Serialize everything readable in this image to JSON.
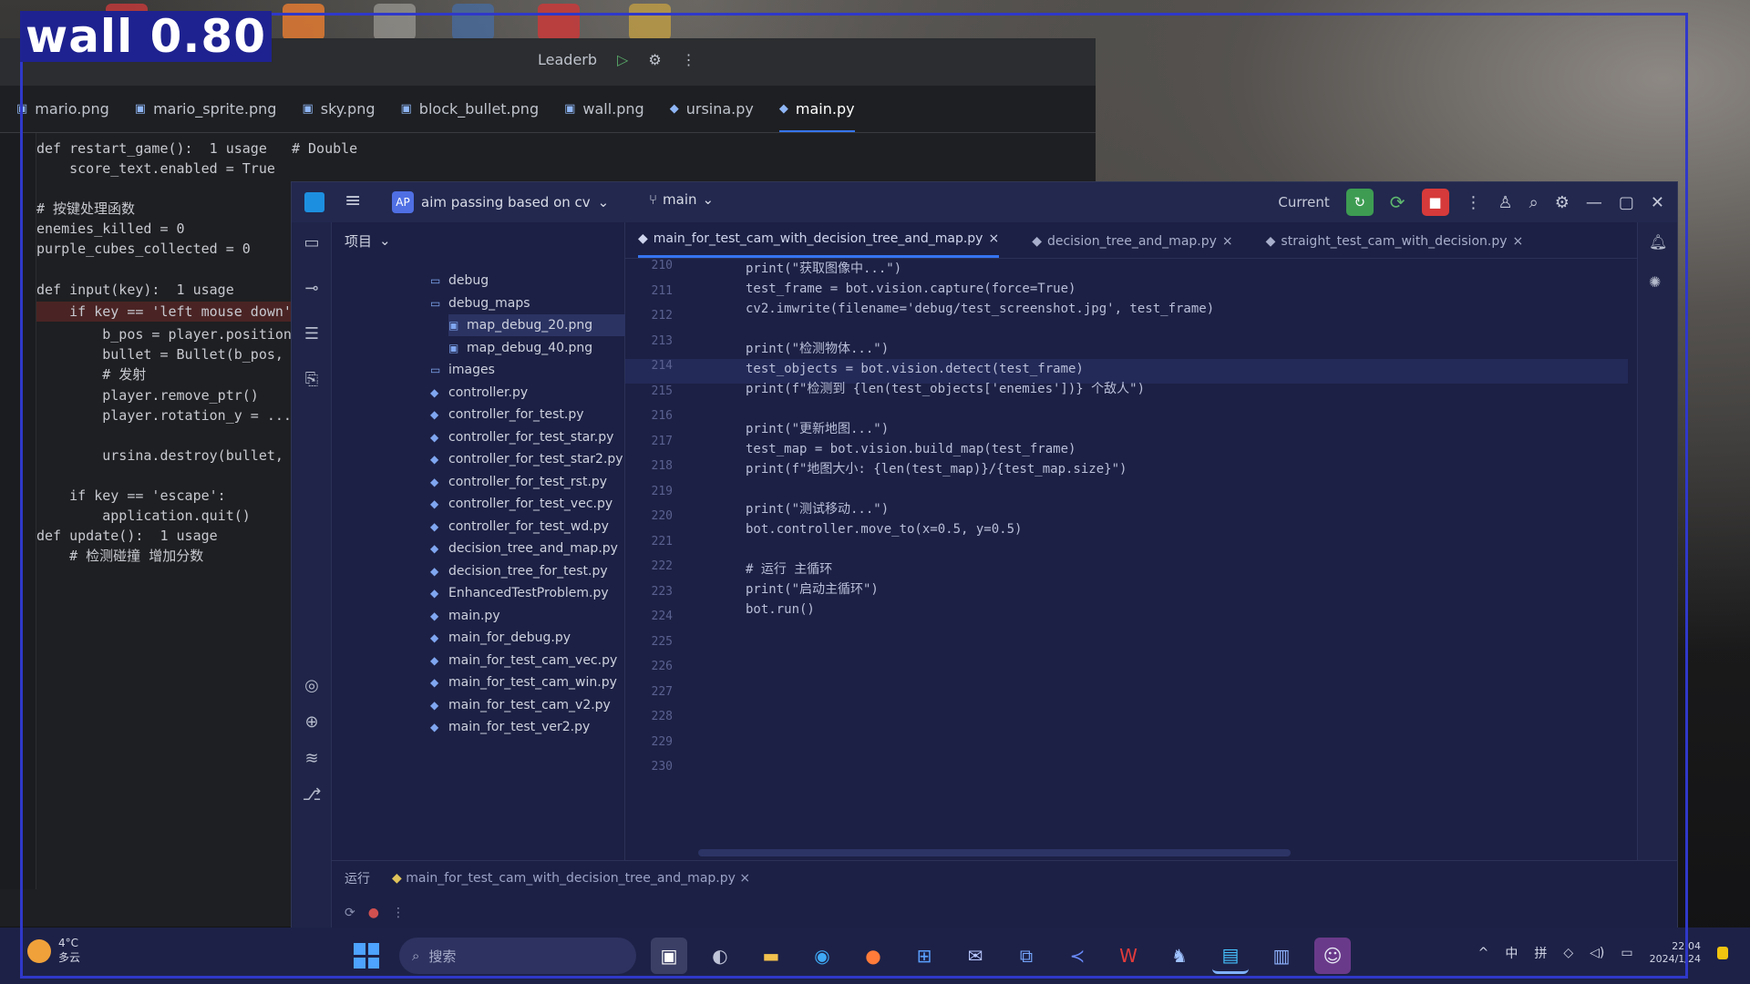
{
  "overlay": {
    "label": "wall 0.80"
  },
  "back_window": {
    "title_items": [
      "Leaderb",
      "▷",
      "⚙",
      "⋮"
    ],
    "tabs": [
      {
        "label": "mario.png",
        "active": false
      },
      {
        "label": "mario_sprite.png",
        "active": false
      },
      {
        "label": "sky.png",
        "active": false
      },
      {
        "label": "block_bullet.png",
        "active": false
      },
      {
        "label": "wall.png",
        "active": false
      },
      {
        "label": "ursina.py",
        "active": false
      },
      {
        "label": "main.py",
        "active": true
      }
    ],
    "code_lines": [
      "def restart_game():  1 usage   # Double",
      "    score_text.enabled = True",
      "",
      "# 按键处理函数",
      "enemies_killed = 0",
      "purple_cubes_collected = 0",
      "",
      "def input(key):  1 usage",
      "    if key == 'left mouse down':",
      "        b_pos = player.position",
      "        bullet = Bullet(b_pos, ...)",
      "        # 发射",
      "        player.remove_ptr()",
      "        player.rotation_y = ...",
      "",
      "        ursina.destroy(bullet, ...)",
      "",
      "    if key == 'escape':",
      "        application.quit()",
      "def update():  1 usage",
      "    # 检测碰撞 增加分数"
    ]
  },
  "front_window": {
    "project_name": "aim passing based on cv",
    "branch": "main",
    "run_config": "Current",
    "project_panel_title": "项目",
    "tree": [
      {
        "label": "debug",
        "type": "folder",
        "indent": 1,
        "selected": false
      },
      {
        "label": "debug_maps",
        "type": "folder",
        "indent": 1,
        "selected": false
      },
      {
        "label": "map_debug_20.png",
        "type": "file",
        "indent": 2,
        "selected": true
      },
      {
        "label": "map_debug_40.png",
        "type": "file",
        "indent": 2,
        "selected": false
      },
      {
        "label": "images",
        "type": "folder",
        "indent": 1,
        "selected": false
      },
      {
        "label": "controller.py",
        "type": "py",
        "indent": 1,
        "selected": false
      },
      {
        "label": "controller_for_test.py",
        "type": "py",
        "indent": 1,
        "selected": false
      },
      {
        "label": "controller_for_test_star.py",
        "type": "py",
        "indent": 1,
        "selected": false
      },
      {
        "label": "controller_for_test_star2.py",
        "type": "py",
        "indent": 1,
        "selected": false
      },
      {
        "label": "controller_for_test_rst.py",
        "type": "py",
        "indent": 1,
        "selected": false
      },
      {
        "label": "controller_for_test_vec.py",
        "type": "py",
        "indent": 1,
        "selected": false
      },
      {
        "label": "controller_for_test_wd.py",
        "type": "py",
        "indent": 1,
        "selected": false
      },
      {
        "label": "decision_tree_and_map.py",
        "type": "py",
        "indent": 1,
        "selected": false
      },
      {
        "label": "decision_tree_for_test.py",
        "type": "py",
        "indent": 1,
        "selected": false
      },
      {
        "label": "EnhancedTestProblem.py",
        "type": "py",
        "indent": 1,
        "selected": false
      },
      {
        "label": "main.py",
        "type": "py",
        "indent": 1,
        "selected": false
      },
      {
        "label": "main_for_debug.py",
        "type": "py",
        "indent": 1,
        "selected": false
      },
      {
        "label": "main_for_test_cam_vec.py",
        "type": "py",
        "indent": 1,
        "selected": false
      },
      {
        "label": "main_for_test_cam_win.py",
        "type": "py",
        "indent": 1,
        "selected": false
      },
      {
        "label": "main_for_test_cam_v2.py",
        "type": "py",
        "indent": 1,
        "selected": false
      },
      {
        "label": "main_for_test_ver2.py",
        "type": "py",
        "indent": 1,
        "selected": false
      }
    ],
    "editor_tabs": [
      {
        "label": "main_for_test_cam_with_decision_tree_and_map.py",
        "active": true
      },
      {
        "label": "decision_tree_and_map.py",
        "active": false
      },
      {
        "label": "straight_test_cam_with_decision.py",
        "active": false
      }
    ],
    "gutter": [
      "210",
      "211",
      "212",
      "213",
      "214",
      "215",
      "216",
      "217",
      "218",
      "219",
      "220",
      "221",
      "222",
      "223",
      "224",
      "225",
      "226",
      "227",
      "228",
      "229",
      "230"
    ],
    "code_lines": [
      "print(\"获取图像中...\")",
      "test_frame = bot.vision.capture(force=True)",
      "cv2.imwrite(filename='debug/test_screenshot.jpg', test_frame)",
      "",
      "print(\"检测物体...\")",
      "test_objects = bot.vision.detect(test_frame)",
      "print(f\"检测到 {len(test_objects['enemies'])} 个敌人\")",
      "",
      "print(\"更新地图...\")",
      "test_map = bot.vision.build_map(test_frame)",
      "print(f\"地图大小: {len(test_map)}/{test_map.size}\")",
      "",
      "print(\"测试移动...\")",
      "bot.controller.move_to(x=0.5, y=0.5)",
      "",
      "# 运行 主循环",
      "print(\"启动主循环\")",
      "bot.run()"
    ],
    "bottom_tab": "main_for_test_cam_with_decision_tree_and_map.py",
    "bottom_label": "运行"
  },
  "taskbar": {
    "weather": [
      "4°C",
      "多云"
    ],
    "search_placeholder": "搜索",
    "clock": [
      "2024/1/24",
      "22:04"
    ],
    "tray": [
      "^",
      "中",
      "拼"
    ]
  }
}
